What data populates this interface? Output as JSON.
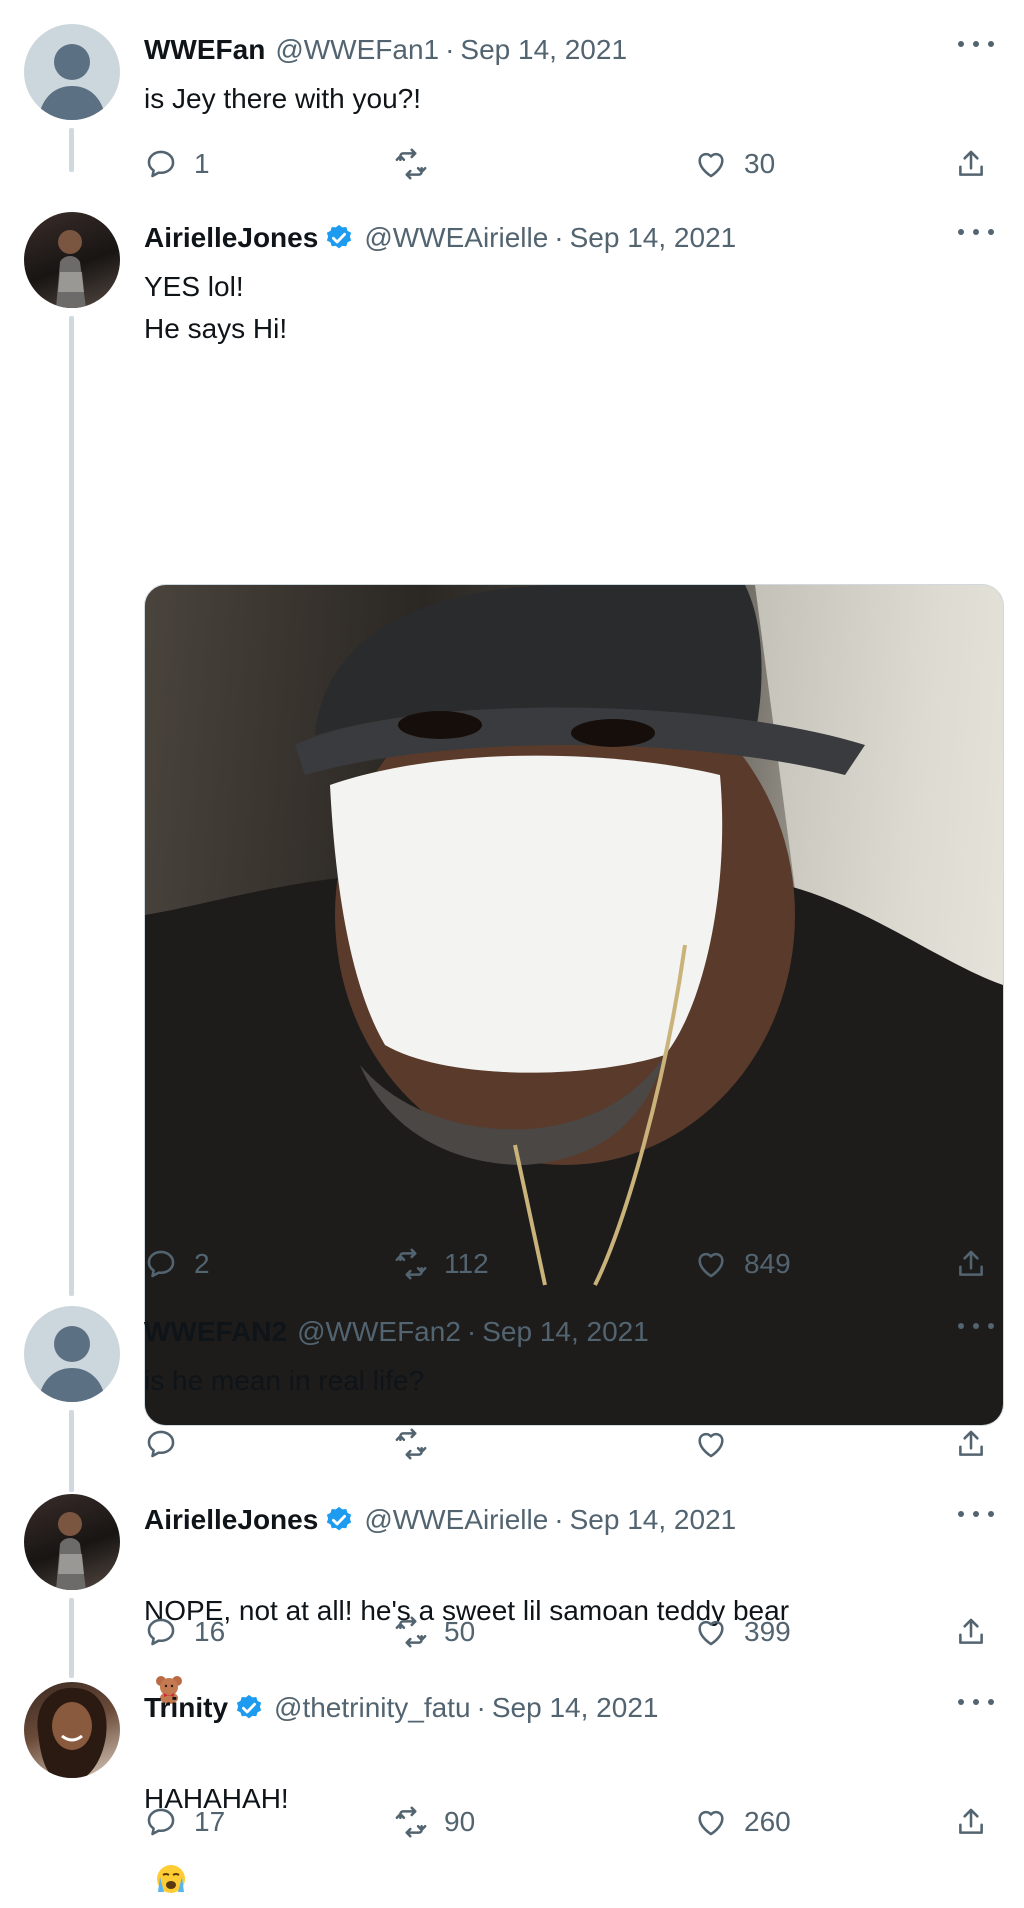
{
  "tweets": [
    {
      "name": "WWEFan",
      "handle": "@WWEFan1",
      "date": "Sep 14, 2021",
      "text": "is Jey there with you?!",
      "verified": false,
      "replies": "1",
      "retweets": "",
      "likes": "30"
    },
    {
      "name": "AirielleJones",
      "handle": "@WWEAirielle",
      "date": "Sep 14, 2021",
      "text": "YES lol!\nHe says Hi!",
      "verified": true,
      "replies": "2",
      "retweets": "112",
      "likes": "849"
    },
    {
      "name": "WWEFAN2",
      "handle": "@WWEFan2",
      "date": "Sep 14, 2021",
      "text": "is he mean in real life?",
      "verified": false,
      "replies": "",
      "retweets": "",
      "likes": ""
    },
    {
      "name": "AirielleJones",
      "handle": "@WWEAirielle",
      "date": "Sep 14, 2021",
      "text": "NOPE, not at all! he's a sweet lil samoan teddy bear",
      "verified": true,
      "replies": "16",
      "retweets": "50",
      "likes": "399"
    },
    {
      "name": "Trinity",
      "handle": "@thetrinity_fatu",
      "date": "Sep 14, 2021",
      "text": "HAHAHAH!",
      "verified": true,
      "replies": "17",
      "retweets": "90",
      "likes": "260"
    }
  ],
  "separator": "·",
  "colors": {
    "verified": "#1d9bf0",
    "muted": "#536471",
    "thread": "#cfd9de"
  }
}
